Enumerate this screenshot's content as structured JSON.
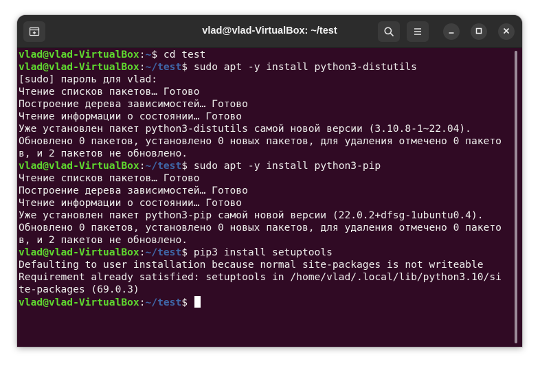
{
  "window": {
    "title": "vlad@vlad-VirtualBox: ~/test",
    "icons": {
      "new_tab": "new-tab-icon",
      "search": "search-icon",
      "menu": "hamburger-menu-icon",
      "minimize": "minimize-icon",
      "maximize": "maximize-icon",
      "close": "close-icon"
    }
  },
  "colors": {
    "terminal_bg": "#300a24",
    "prompt_user": "#5fd82f",
    "prompt_path": "#3f67a8",
    "text": "#eeeeec"
  },
  "terminal": {
    "lines": [
      {
        "prompt": true,
        "user": "vlad@vlad-VirtualBox",
        "path": "~",
        "cmd": " cd test"
      },
      {
        "prompt": true,
        "user": "vlad@vlad-VirtualBox",
        "path": "~/test",
        "cmd": " sudo apt -y install python3-distutils"
      },
      {
        "prompt": false,
        "text": "[sudo] пароль для vlad:"
      },
      {
        "prompt": false,
        "text": "Чтение списков пакетов… Готово"
      },
      {
        "prompt": false,
        "text": "Построение дерева зависимостей… Готово"
      },
      {
        "prompt": false,
        "text": "Чтение информации о состоянии… Готово"
      },
      {
        "prompt": false,
        "text": "Уже установлен пакет python3-distutils самой новой версии (3.10.8-1~22.04)."
      },
      {
        "prompt": false,
        "text": "Обновлено 0 пакетов, установлено 0 новых пакетов, для удаления отмечено 0 пакето"
      },
      {
        "prompt": false,
        "text": "в, и 2 пакетов не обновлено."
      },
      {
        "prompt": true,
        "user": "vlad@vlad-VirtualBox",
        "path": "~/test",
        "cmd": " sudo apt -y install python3-pip"
      },
      {
        "prompt": false,
        "text": "Чтение списков пакетов… Готово"
      },
      {
        "prompt": false,
        "text": "Построение дерева зависимостей… Готово"
      },
      {
        "prompt": false,
        "text": "Чтение информации о состоянии… Готово"
      },
      {
        "prompt": false,
        "text": "Уже установлен пакет python3-pip самой новой версии (22.0.2+dfsg-1ubuntu0.4)."
      },
      {
        "prompt": false,
        "text": "Обновлено 0 пакетов, установлено 0 новых пакетов, для удаления отмечено 0 пакето"
      },
      {
        "prompt": false,
        "text": "в, и 2 пакетов не обновлено."
      },
      {
        "prompt": true,
        "user": "vlad@vlad-VirtualBox",
        "path": "~/test",
        "cmd": " pip3 install setuptools"
      },
      {
        "prompt": false,
        "text": "Defaulting to user installation because normal site-packages is not writeable"
      },
      {
        "prompt": false,
        "text": "Requirement already satisfied: setuptools in /home/vlad/.local/lib/python3.10/si"
      },
      {
        "prompt": false,
        "text": "te-packages (69.0.3)"
      },
      {
        "prompt": true,
        "user": "vlad@vlad-VirtualBox",
        "path": "~/test",
        "cmd": " ",
        "cursor": true
      }
    ]
  }
}
